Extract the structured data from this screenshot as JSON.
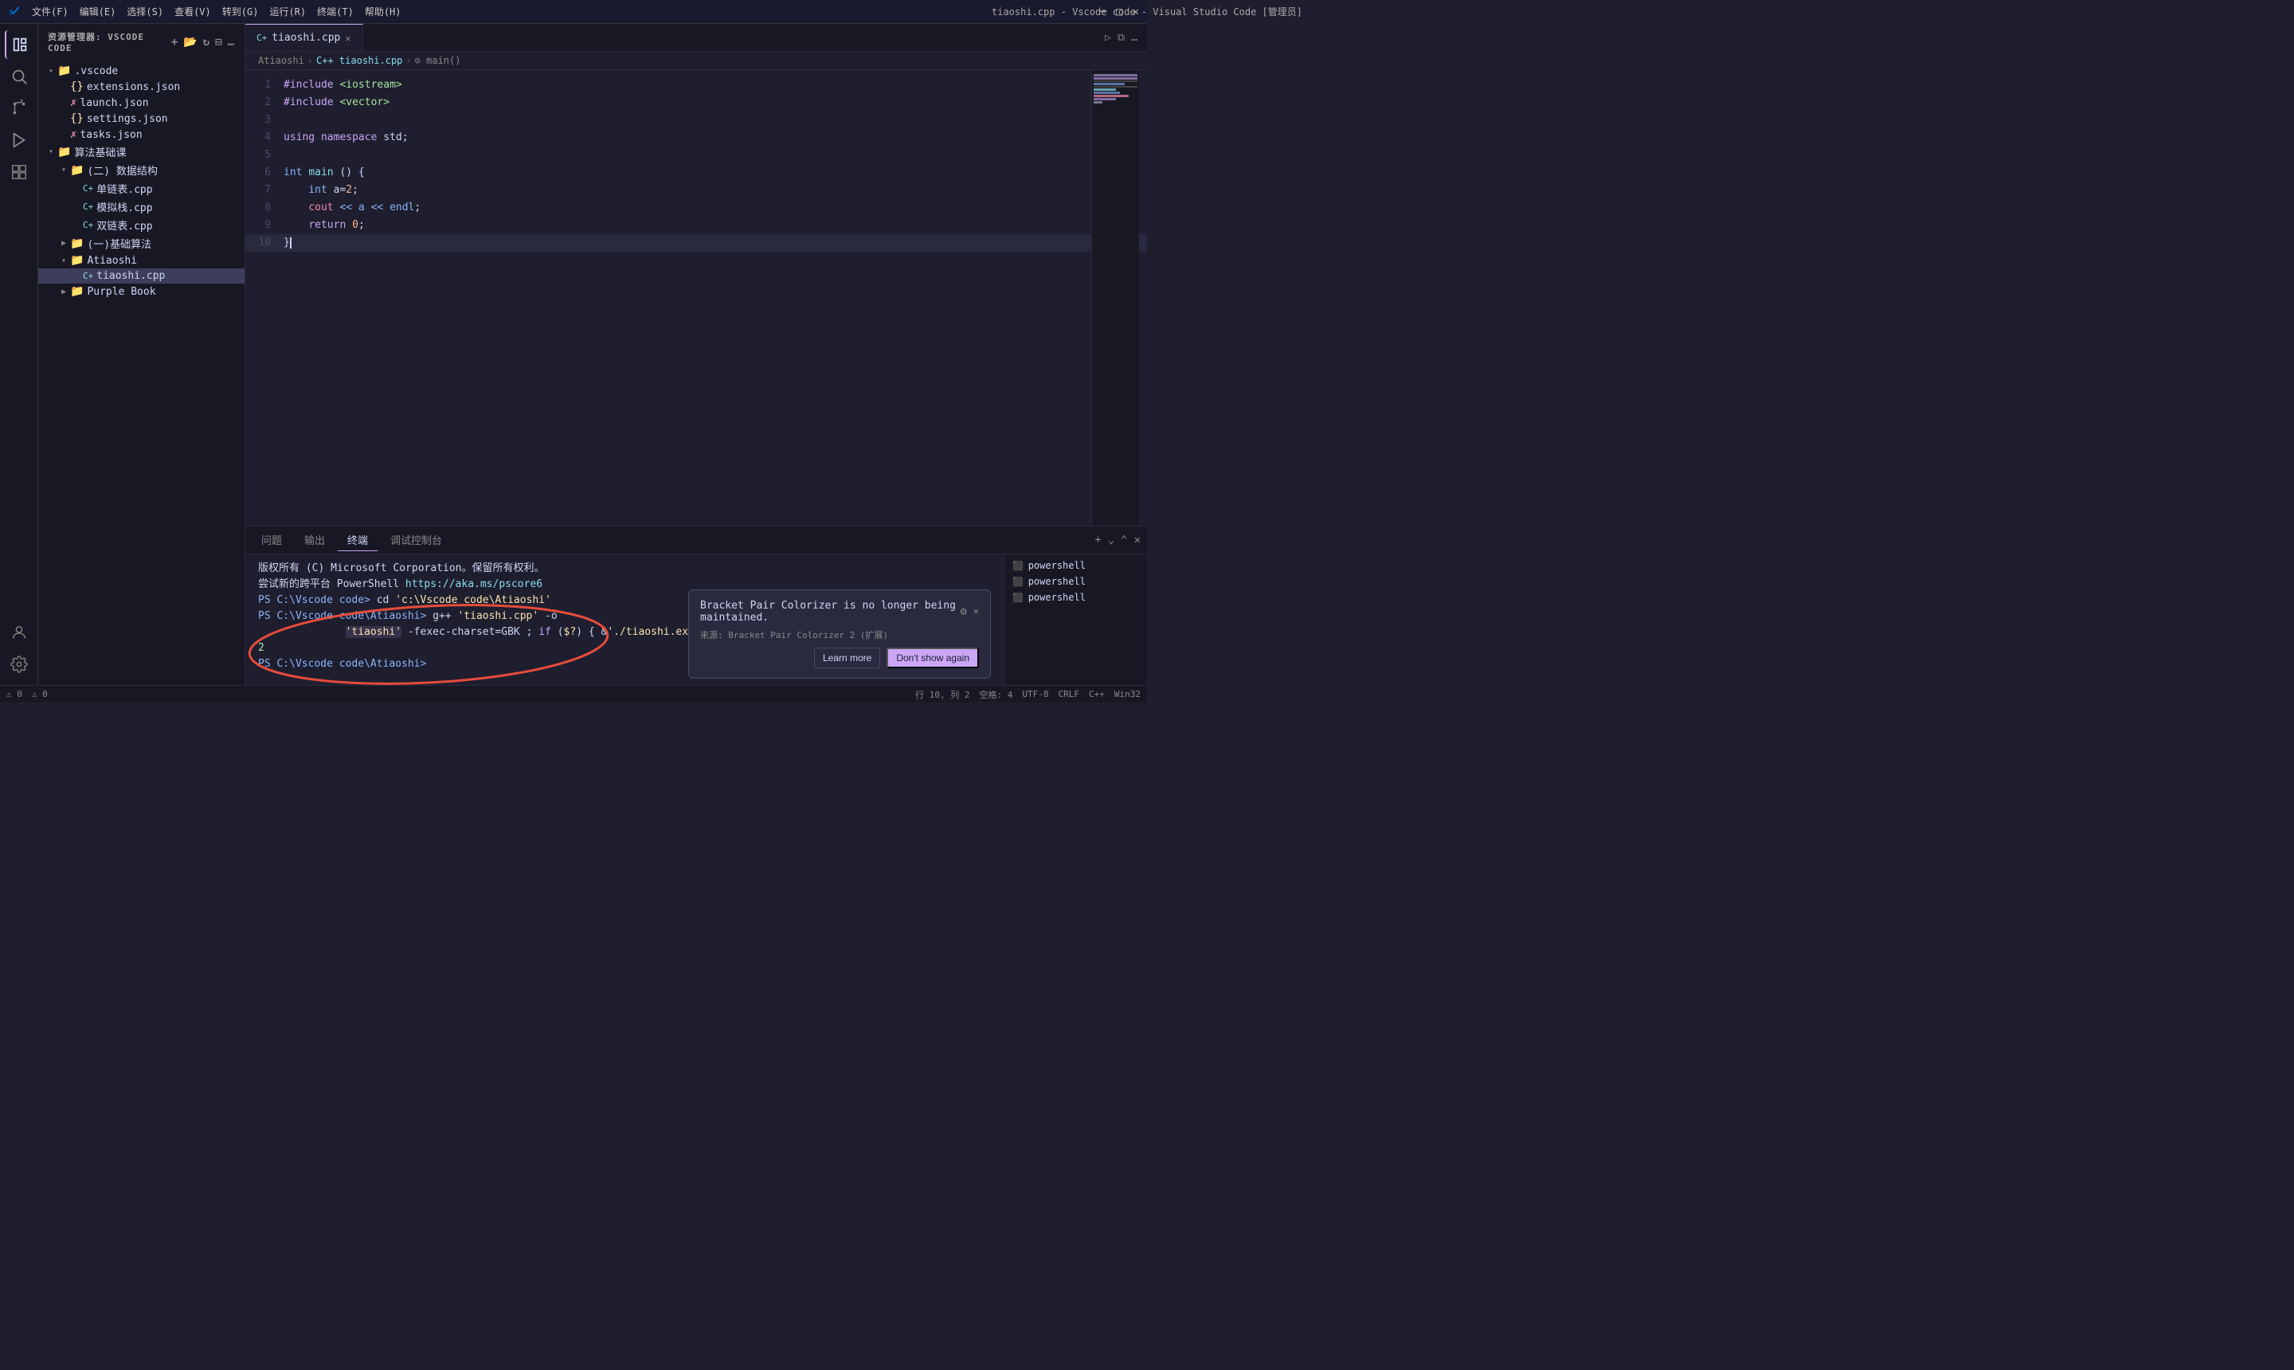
{
  "titlebar": {
    "title": "tiaoshi.cpp - Vscode code - Visual Studio Code [管理员]",
    "menu": [
      "文件(F)",
      "编辑(E)",
      "选择(S)",
      "查看(V)",
      "转到(G)",
      "运行(R)",
      "终端(T)",
      "帮助(H)"
    ]
  },
  "tab": {
    "filename": "tiaoshi.cpp",
    "icon": "C++"
  },
  "breadcrumb": {
    "parts": [
      "Atiaoshi",
      ">",
      "C++ tiaoshi.cpp",
      ">",
      "⊙ main()"
    ]
  },
  "sidebar": {
    "header": "资源管理器: VSCODE CODE",
    "tree": [
      {
        "indent": 0,
        "arrow": "▾",
        "icon": "📁",
        "label": ".vscode",
        "type": "folder"
      },
      {
        "indent": 1,
        "arrow": "",
        "icon": "{}",
        "label": "extensions.json",
        "type": "json"
      },
      {
        "indent": 1,
        "arrow": "",
        "icon": "✗",
        "label": "launch.json",
        "type": "json-x"
      },
      {
        "indent": 1,
        "arrow": "",
        "icon": "{}",
        "label": "settings.json",
        "type": "json"
      },
      {
        "indent": 1,
        "arrow": "",
        "icon": "✗",
        "label": "tasks.json",
        "type": "json-x"
      },
      {
        "indent": 0,
        "arrow": "▾",
        "icon": "📁",
        "label": "算法基础课",
        "type": "folder"
      },
      {
        "indent": 1,
        "arrow": "▾",
        "icon": "📁",
        "label": "(二) 数据结构",
        "type": "folder"
      },
      {
        "indent": 2,
        "arrow": "",
        "icon": "C+",
        "label": "单链表.cpp",
        "type": "cpp"
      },
      {
        "indent": 2,
        "arrow": "",
        "icon": "C+",
        "label": "模拟栈.cpp",
        "type": "cpp"
      },
      {
        "indent": 2,
        "arrow": "",
        "icon": "C+",
        "label": "双链表.cpp",
        "type": "cpp"
      },
      {
        "indent": 1,
        "arrow": "▶",
        "icon": "📁",
        "label": "(一)基础算法",
        "type": "folder"
      },
      {
        "indent": 1,
        "arrow": "▾",
        "icon": "📁",
        "label": "Atiaoshi",
        "type": "folder"
      },
      {
        "indent": 2,
        "arrow": "",
        "icon": "C+",
        "label": "tiaoshi.cpp",
        "type": "cpp",
        "active": true
      },
      {
        "indent": 1,
        "arrow": "▶",
        "icon": "📁",
        "label": "Purple Book",
        "type": "folder"
      }
    ]
  },
  "code": {
    "lines": [
      {
        "num": 1,
        "tokens": [
          {
            "t": "#include",
            "c": "kw-include"
          },
          {
            "t": " ",
            "c": ""
          },
          {
            "t": "<iostream>",
            "c": "str-header"
          }
        ]
      },
      {
        "num": 2,
        "tokens": [
          {
            "t": "#include",
            "c": "kw-include"
          },
          {
            "t": " ",
            "c": ""
          },
          {
            "t": "<vector>",
            "c": "str-header"
          }
        ]
      },
      {
        "num": 3,
        "tokens": []
      },
      {
        "num": 4,
        "tokens": [
          {
            "t": "using",
            "c": "kw-using"
          },
          {
            "t": " ",
            "c": ""
          },
          {
            "t": "namespace",
            "c": "kw-namespace"
          },
          {
            "t": " ",
            "c": ""
          },
          {
            "t": "std;",
            "c": "str-std"
          }
        ]
      },
      {
        "num": 5,
        "tokens": []
      },
      {
        "num": 6,
        "tokens": [
          {
            "t": "int",
            "c": "kw-int"
          },
          {
            "t": " ",
            "c": ""
          },
          {
            "t": "main",
            "c": "fn-main"
          },
          {
            "t": " () {",
            "c": "punc"
          }
        ]
      },
      {
        "num": 7,
        "tokens": [
          {
            "t": "    ",
            "c": ""
          },
          {
            "t": "int",
            "c": "kw-int"
          },
          {
            "t": " a=",
            "c": "var-a"
          },
          {
            "t": "2",
            "c": "num"
          },
          {
            "t": ";",
            "c": "punc"
          }
        ]
      },
      {
        "num": 8,
        "tokens": [
          {
            "t": "    ",
            "c": ""
          },
          {
            "t": "cout",
            "c": "kw-cout"
          },
          {
            "t": " << a << ",
            "c": "op"
          },
          {
            "t": "endl",
            "c": "str-endl"
          },
          {
            "t": ";",
            "c": "punc"
          }
        ]
      },
      {
        "num": 9,
        "tokens": [
          {
            "t": "    ",
            "c": ""
          },
          {
            "t": "return",
            "c": "kw-return"
          },
          {
            "t": " ",
            "c": ""
          },
          {
            "t": "0",
            "c": "num"
          },
          {
            "t": ";",
            "c": "punc"
          }
        ]
      },
      {
        "num": 10,
        "tokens": [
          {
            "t": "}",
            "c": "punc"
          }
        ]
      }
    ]
  },
  "panel": {
    "tabs": [
      "问题",
      "输出",
      "终端",
      "调试控制台"
    ],
    "active_tab": "终端",
    "terminal_lines": [
      {
        "text": "版权所有 (C) Microsoft Corporation。保留所有权利。",
        "class": ""
      },
      {
        "text": "",
        "class": ""
      },
      {
        "text": "尝试新的跨平台 PowerShell https://aka.ms/pscore6",
        "class": ""
      },
      {
        "text": "",
        "class": ""
      },
      {
        "text": "PS C:\\Vscode code> cd 'c:\\Vscode code\\Atiaoshi'",
        "class": ""
      },
      {
        "text": "PS C:\\Vscode code\\Atiaoshi> g++ 'tiaoshi.cpp' -o 'tiaoshi' -fexec-charset=GBK ; if ($?) { &'./tiaoshi.exe' }",
        "class": ""
      },
      {
        "text": "2",
        "class": "t-highlight"
      },
      {
        "text": "PS C:\\Vscode code\\Atiaoshi>",
        "class": ""
      }
    ],
    "terminal_instances": [
      "powershell",
      "powershell",
      "powershell"
    ]
  },
  "notification": {
    "title": "Bracket Pair Colorizer is no longer being maintained.",
    "gear_icon": "⚙",
    "close_icon": "✕",
    "source": "来源: Bracket Pair Colorizer 2 (扩展)",
    "buttons": [
      "Learn more",
      "Don't show again"
    ]
  },
  "status_bar": {
    "left": [
      "⚠ 0",
      "⚠ 0"
    ],
    "right": [
      "行 10, 列 2",
      "空格: 4",
      "UTF-8",
      "CRLF",
      "C++",
      "Win32"
    ]
  }
}
